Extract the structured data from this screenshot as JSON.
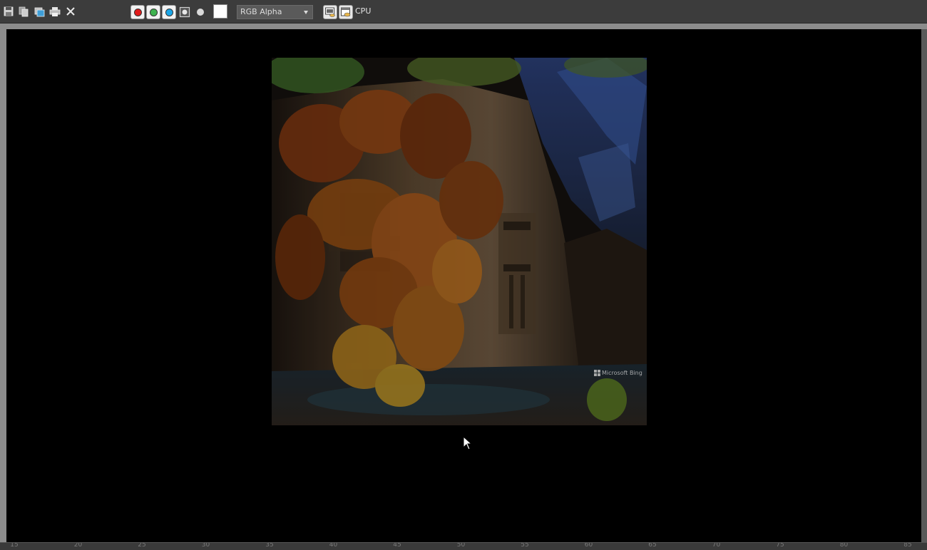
{
  "toolbar": {
    "buttons": [
      {
        "name": "save-image-icon"
      },
      {
        "name": "clone-window-icon"
      },
      {
        "name": "copy-image-icon"
      },
      {
        "name": "print-icon"
      },
      {
        "name": "clear-icon"
      }
    ],
    "channels": [
      {
        "name": "red-channel-button",
        "color": "#e11b1b"
      },
      {
        "name": "green-channel-button",
        "color": "#3fb34f"
      },
      {
        "name": "blue-channel-button",
        "color": "#1aa6e8"
      }
    ],
    "display_mode": {
      "selected": "RGB Alpha"
    },
    "renderer_label": "CPU"
  },
  "image": {
    "watermark": "Microsoft Bing"
  },
  "colors": {
    "toolbar_bg": "#3c3c3c",
    "viewport_bg": "#000000",
    "frame": "#8c8c8c"
  },
  "ruler": {
    "ticks": [
      "15",
      "20",
      "25",
      "30",
      "35",
      "40",
      "45",
      "50",
      "55",
      "60",
      "65",
      "70",
      "75",
      "80",
      "85"
    ]
  }
}
